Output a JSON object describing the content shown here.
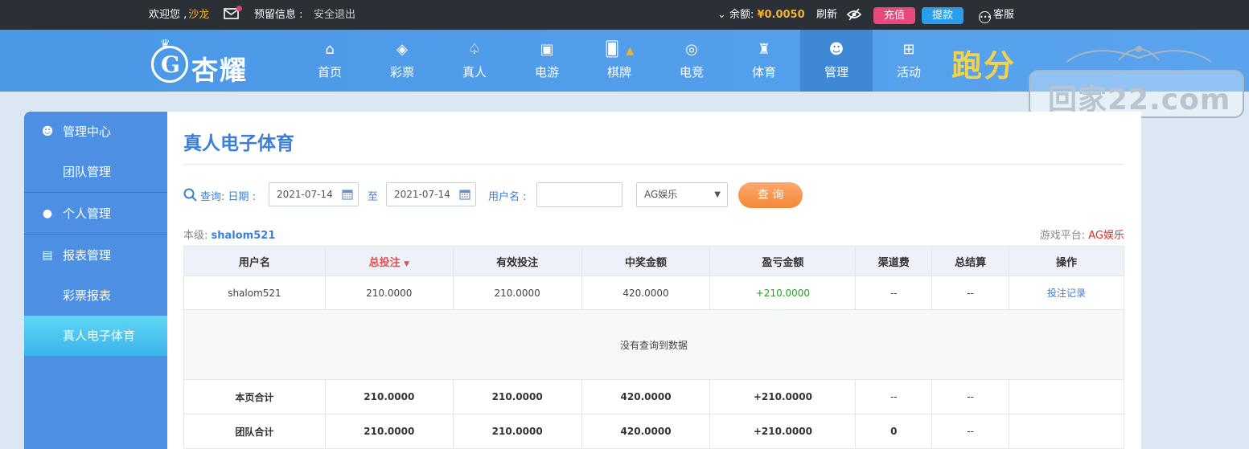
{
  "topbar": {
    "welcome": "欢迎您 ,",
    "username": "沙龙",
    "reserve_label": "预留信息 :",
    "logout": "安全退出",
    "balance_label": "余额:",
    "balance_value": "¥0.0050",
    "refresh": "刷新",
    "recharge": "充值",
    "withdraw": "提款",
    "service": "客服"
  },
  "logo": {
    "brand": "杏耀",
    "initial": "G"
  },
  "nav": [
    {
      "label": "首页",
      "icon": "home-icon"
    },
    {
      "label": "彩票",
      "icon": "lottery-icon"
    },
    {
      "label": "真人",
      "icon": "live-dealer-icon"
    },
    {
      "label": "电游",
      "icon": "slot-icon"
    },
    {
      "label": "棋牌",
      "icon": "card-icon"
    },
    {
      "label": "电竞",
      "icon": "gamepad-icon"
    },
    {
      "label": "体育",
      "icon": "trophy-icon"
    },
    {
      "label": "管理",
      "icon": "users-icon",
      "active": true
    },
    {
      "label": "活动",
      "icon": "gift-icon"
    }
  ],
  "promo": "跑分",
  "watermark": "回家22.com",
  "sidebar": [
    {
      "label": "管理中心",
      "icon": "users-icon"
    },
    {
      "label": "团队管理"
    },
    {
      "label": "个人管理",
      "icon": "user-icon"
    },
    {
      "label": "报表管理",
      "icon": "report-icon"
    },
    {
      "label": "彩票报表"
    },
    {
      "label": "真人电子体育",
      "active": true
    }
  ],
  "page": {
    "title": "真人电子体育",
    "query_label": "查询:",
    "date_label": "日期 :",
    "date_from": "2021-07-14",
    "to": "至",
    "date_to": "2021-07-14",
    "user_label": "用户名 :",
    "user_value": "",
    "platform_selected": "AG娱乐",
    "query_button": "查 询",
    "level_label": "本级:",
    "level_value": "shalom521",
    "platform_label": "游戏平台:",
    "platform_value": "AG娱乐"
  },
  "table": {
    "headers": [
      "用户名",
      "总投注",
      "有效投注",
      "中奖金额",
      "盈亏金额",
      "渠道费",
      "总结算",
      "操作"
    ],
    "sorted_column": "总投注",
    "row": {
      "user": "shalom521",
      "total_bet": "210.0000",
      "valid_bet": "210.0000",
      "win": "420.0000",
      "profit": "+210.0000",
      "channel_fee": "--",
      "settle": "--",
      "action": "投注记录"
    },
    "empty_text": "没有查询到数据",
    "page_total": {
      "label": "本页合计",
      "total_bet": "210.0000",
      "valid_bet": "210.0000",
      "win": "420.0000",
      "profit": "+210.0000",
      "channel_fee": "--",
      "settle": "--"
    },
    "team_total": {
      "label": "团队合计",
      "total_bet": "210.0000",
      "valid_bet": "210.0000",
      "win": "420.0000",
      "profit": "+210.0000",
      "channel_fee": "0",
      "settle": "--"
    }
  },
  "colors": {
    "accent": "#3c7fd8",
    "nav": "#4a97e6",
    "gold": "#f3b233",
    "profit": "#2aa12a"
  }
}
